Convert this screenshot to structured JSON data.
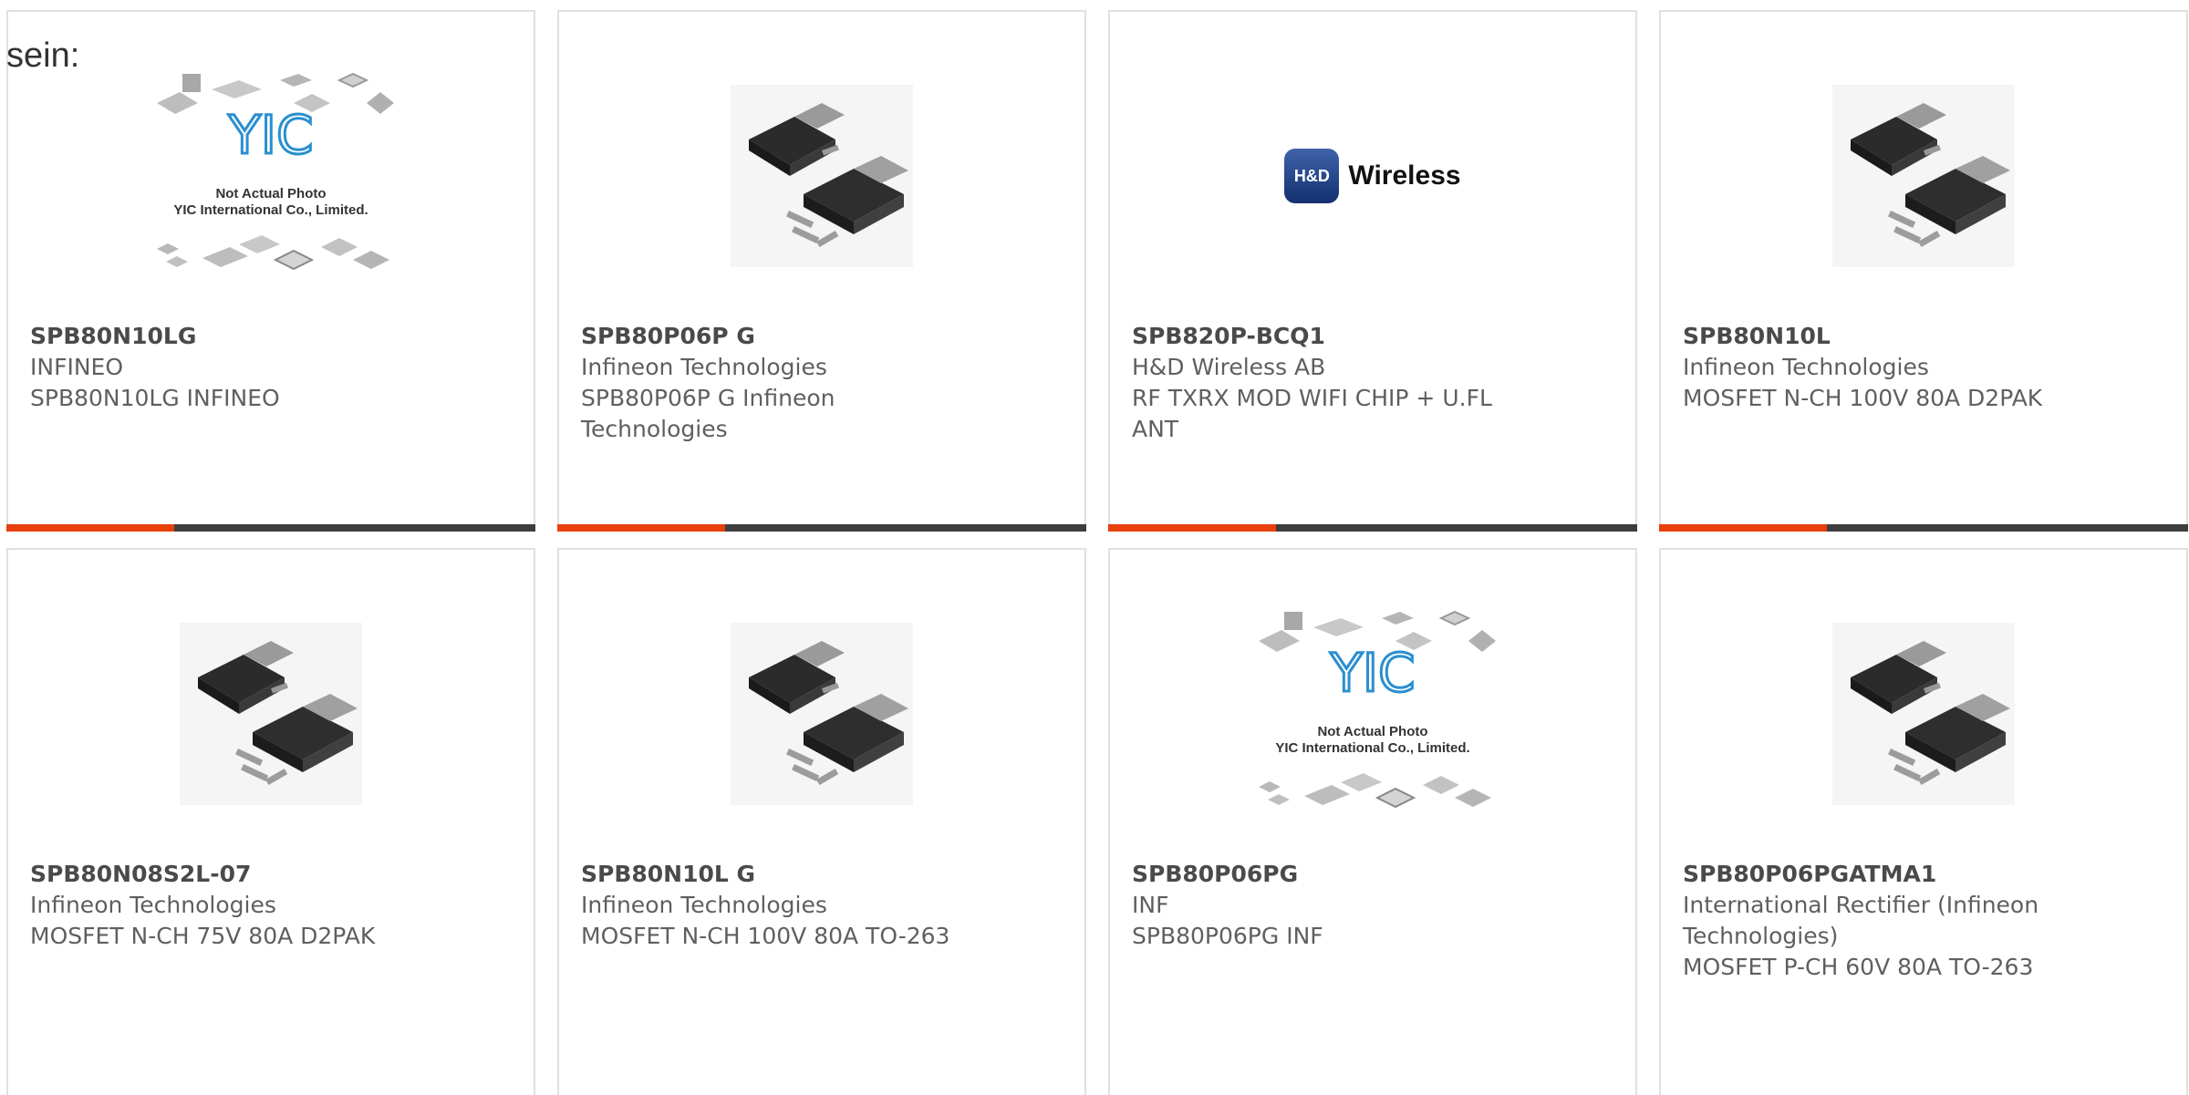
{
  "intro_text": "sein:",
  "colors": {
    "accent": "#e8400c",
    "bar_dark": "#3d3d3d",
    "border": "#e0e0e0",
    "text": "#5f5f5f"
  },
  "placeholder_image": {
    "caption_line1": "Not Actual Photo",
    "caption_line2": "YIC International Co., Limited.",
    "logo_text": "YIC"
  },
  "hd_logo": {
    "badge": "H&D",
    "word": "Wireless"
  },
  "products": [
    {
      "part": "SPB80N10LG",
      "manufacturer": "INFINEO",
      "description": "SPB80N10LG INFINEO",
      "image": "placeholder-photo"
    },
    {
      "part": "SPB80P06P G",
      "manufacturer": "Infineon Technologies",
      "description": "SPB80P06P G Infineon Technologies",
      "image": "d2pak-package"
    },
    {
      "part": "SPB820P-BCQ1",
      "manufacturer": "H&D Wireless AB",
      "description": "RF TXRX MOD WIFI CHIP + U.FL ANT",
      "image": "hd-wireless-logo"
    },
    {
      "part": "SPB80N10L",
      "manufacturer": "Infineon Technologies",
      "description": "MOSFET N-CH 100V 80A D2PAK",
      "image": "d2pak-package"
    },
    {
      "part": "SPB80N08S2L-07",
      "manufacturer": "Infineon Technologies",
      "description": "MOSFET N-CH 75V 80A D2PAK",
      "image": "d2pak-package"
    },
    {
      "part": "SPB80N10L G",
      "manufacturer": "Infineon Technologies",
      "description": "MOSFET N-CH 100V 80A TO-263",
      "image": "d2pak-package"
    },
    {
      "part": "SPB80P06PG",
      "manufacturer": "INF",
      "description": "SPB80P06PG INF",
      "image": "placeholder-photo"
    },
    {
      "part": "SPB80P06PGATMA1",
      "manufacturer": "International Rectifier (Infineon Technologies)",
      "description": "MOSFET P-CH 60V 80A TO-263",
      "image": "d2pak-package"
    }
  ]
}
